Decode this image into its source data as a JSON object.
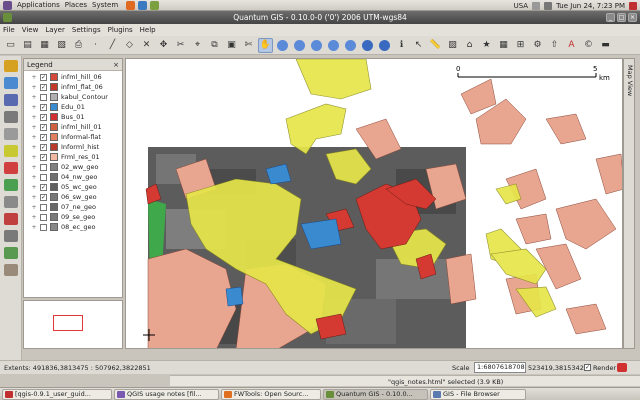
{
  "top_panel": {
    "menus": [
      "Applications",
      "Places",
      "System"
    ],
    "locale": "USA",
    "clock": "Tue Jun 24,  7:23 PM"
  },
  "window": {
    "title": "Quantum GIS - 0.10.0-0 ('0')  2006 UTM-wgs84"
  },
  "menubar": [
    "File",
    "View",
    "Layer",
    "Settings",
    "Plugins",
    "Help"
  ],
  "legend": {
    "title": "Legend",
    "layers": [
      {
        "name": "infml_hill_06",
        "checked": true,
        "color": "#d44a3a"
      },
      {
        "name": "infml_flat_06",
        "checked": true,
        "color": "#c43a2a"
      },
      {
        "name": "kabul_Contour",
        "checked": false,
        "color": "#b0b0b0"
      },
      {
        "name": "Edu_01",
        "checked": true,
        "color": "#3a8ad0"
      },
      {
        "name": "Bus_01",
        "checked": true,
        "color": "#d03030"
      },
      {
        "name": "infml_hill_01",
        "checked": true,
        "color": "#d06040"
      },
      {
        "name": "Informal-flat",
        "checked": true,
        "color": "#e08060"
      },
      {
        "name": "Informl_hist",
        "checked": true,
        "color": "#b83a2a"
      },
      {
        "name": "Frml_res_01",
        "checked": true,
        "color": "#f0b8a0"
      },
      {
        "name": "02_ww_geo",
        "checked": false,
        "color": "#808080"
      },
      {
        "name": "04_nw_geo",
        "checked": false,
        "color": "#707070"
      },
      {
        "name": "05_wc_geo",
        "checked": true,
        "color": "#606060"
      },
      {
        "name": "06_sw_geo",
        "checked": true,
        "color": "#787878"
      },
      {
        "name": "07_ne_geo",
        "checked": false,
        "color": "#686868"
      },
      {
        "name": "09_se_geo",
        "checked": false,
        "color": "#7a7a7a"
      },
      {
        "name": "08_ec_geo",
        "checked": false,
        "color": "#888888"
      }
    ]
  },
  "map": {
    "scalebar": {
      "left": "0",
      "right": "5",
      "unit": "km"
    },
    "side_tab": "Map View"
  },
  "status": {
    "extents": "Extents: 491836,3813475 : 507962,3822851",
    "scale_label": "Scale",
    "scale_value": "1:6807618708",
    "coords": "523419,3815342",
    "render_label": "Render",
    "render_checked": true
  },
  "dialog_status": "\"qgis_notes.html\" selected  (3.9 KB)",
  "taskbar": [
    {
      "label": "[qgis-0.9.1_user_guid...",
      "active": false,
      "color": "#c03030"
    },
    {
      "label": "QGIS usage notes [fil...",
      "active": false,
      "color": "#7a5ab0"
    },
    {
      "label": "FWTools: Open Sourc...",
      "active": false,
      "color": "#e07020"
    },
    {
      "label": "Quantum GIS - 0.10.0...",
      "active": true,
      "color": "#6a8f3a"
    },
    {
      "label": "GIS - File Browser",
      "active": false,
      "color": "#5a7ab0"
    }
  ],
  "colors": {
    "yellow": "#e6e64a",
    "salmon": "#e8a590",
    "red": "#d43a32",
    "blue": "#3a8ad0",
    "green": "#3ea84a"
  }
}
